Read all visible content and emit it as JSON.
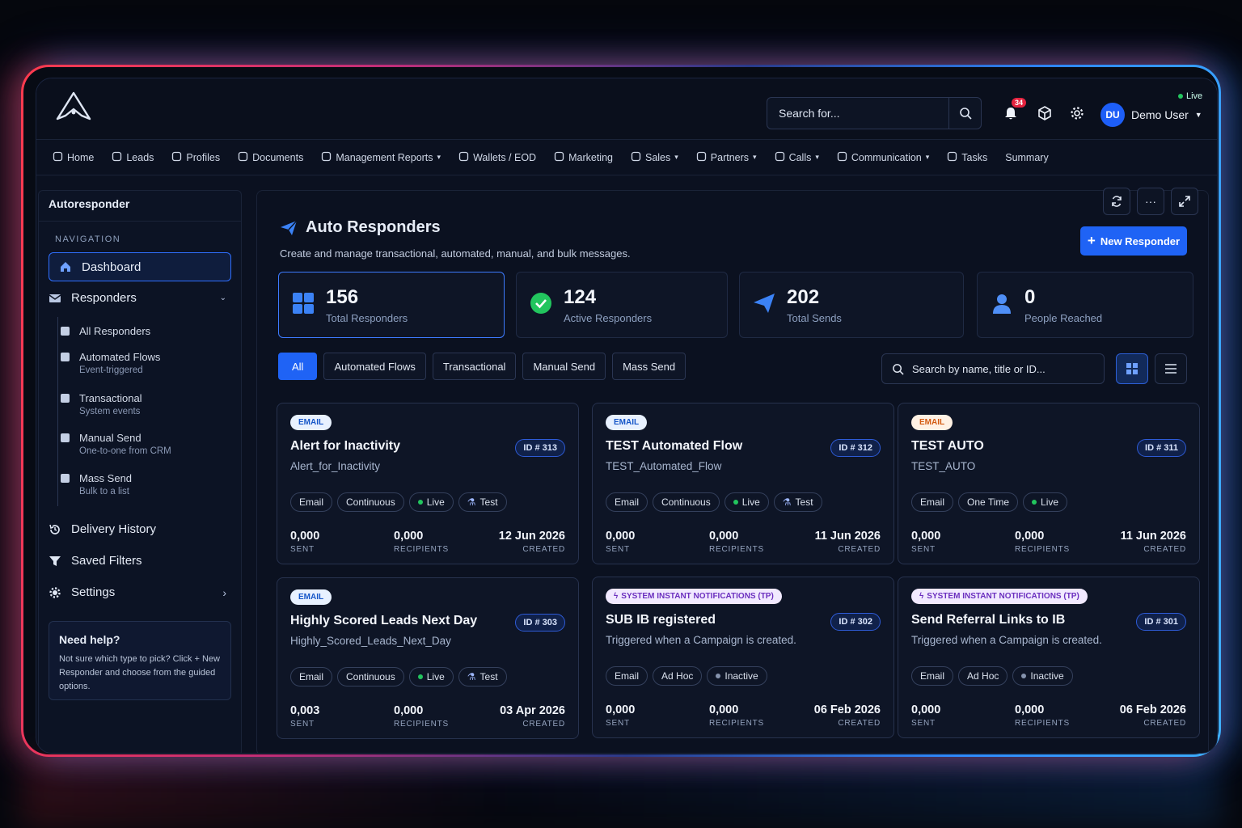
{
  "header": {
    "live_label": "Live",
    "search_placeholder": "Search for...",
    "notification_count": "34",
    "user_initials": "DU",
    "user_name": "Demo User"
  },
  "nav": [
    "Home",
    "Leads",
    "Profiles",
    "Documents",
    "Management Reports",
    "Wallets / EOD",
    "Marketing",
    "Sales",
    "Partners",
    "Calls",
    "Communication",
    "Tasks",
    "Summary"
  ],
  "sidebar": {
    "title": "Autoresponder",
    "section": "NAVIGATION",
    "dashboard": "Dashboard",
    "responders": "Responders",
    "subs": [
      {
        "label": "All Responders",
        "desc": ""
      },
      {
        "label": "Automated Flows",
        "desc": "Event-triggered"
      },
      {
        "label": "Transactional",
        "desc": "System events"
      },
      {
        "label": "Manual Send",
        "desc": "One-to-one from CRM"
      },
      {
        "label": "Mass Send",
        "desc": "Bulk to a list"
      }
    ],
    "delivery_history": "Delivery History",
    "saved_filters": "Saved Filters",
    "settings": "Settings",
    "help_title": "Need help?",
    "help_text": "Not sure which type to pick? Click + New Responder and choose from the guided options."
  },
  "main": {
    "title": "Auto Responders",
    "subtitle": "Create and manage transactional, automated, manual, and bulk messages.",
    "new_button": "New Responder",
    "stats": [
      {
        "value": "156",
        "label": "Total Responders"
      },
      {
        "value": "124",
        "label": "Active Responders"
      },
      {
        "value": "202",
        "label": "Total Sends"
      },
      {
        "value": "0",
        "label": "People Reached"
      }
    ],
    "tabs": [
      "All",
      "Automated Flows",
      "Transactional",
      "Manual Send",
      "Mass Send"
    ],
    "filter_placeholder": "Search by name, title or ID...",
    "labels": {
      "sent": "SENT",
      "recipients": "RECIPIENTS",
      "created": "CREATED"
    },
    "cards": [
      {
        "tag": "EMAIL",
        "id": "ID # 313",
        "title": "Alert for Inactivity",
        "slug": "Alert_for_Inactivity",
        "chips": [
          "Email",
          "Continuous",
          "Live",
          "Test"
        ],
        "sent": "0,000",
        "recipients": "0,000",
        "created": "12 Jun 2026"
      },
      {
        "tag": "EMAIL",
        "id": "ID # 312",
        "title": "TEST Automated Flow",
        "slug": "TEST_Automated_Flow",
        "chips": [
          "Email",
          "Continuous",
          "Live",
          "Test"
        ],
        "sent": "0,000",
        "recipients": "0,000",
        "created": "11 Jun 2026"
      },
      {
        "tag": "EMAIL",
        "id": "ID # 311",
        "title": "TEST AUTO",
        "slug": "TEST_AUTO",
        "chips": [
          "Email",
          "One Time",
          "Live"
        ],
        "sent": "0,000",
        "recipients": "0,000",
        "created": "11 Jun 2026"
      },
      {
        "tag": "EMAIL",
        "id": "ID # 303",
        "title": "Highly Scored Leads Next Day",
        "slug": "Highly_Scored_Leads_Next_Day",
        "chips": [
          "Email",
          "Continuous",
          "Live",
          "Test"
        ],
        "sent": "0,003",
        "recipients": "0,000",
        "created": "03 Apr 2026"
      },
      {
        "tag": "SYSTEM INSTANT NOTIFICATIONS (TP)",
        "id": "ID # 302",
        "title": "SUB IB registered",
        "slug": "Triggered when a Campaign is created.",
        "chips": [
          "Email",
          "Ad Hoc",
          "Inactive"
        ],
        "sent": "0,000",
        "recipients": "0,000",
        "created": "06 Feb 2026"
      },
      {
        "tag": "SYSTEM INSTANT NOTIFICATIONS (TP)",
        "id": "ID # 301",
        "title": "Send Referral Links to IB",
        "slug": "Triggered when a Campaign is created.",
        "chips": [
          "Email",
          "Ad Hoc",
          "Inactive"
        ],
        "sent": "0,000",
        "recipients": "0,000",
        "created": "06 Feb 2026"
      }
    ]
  }
}
